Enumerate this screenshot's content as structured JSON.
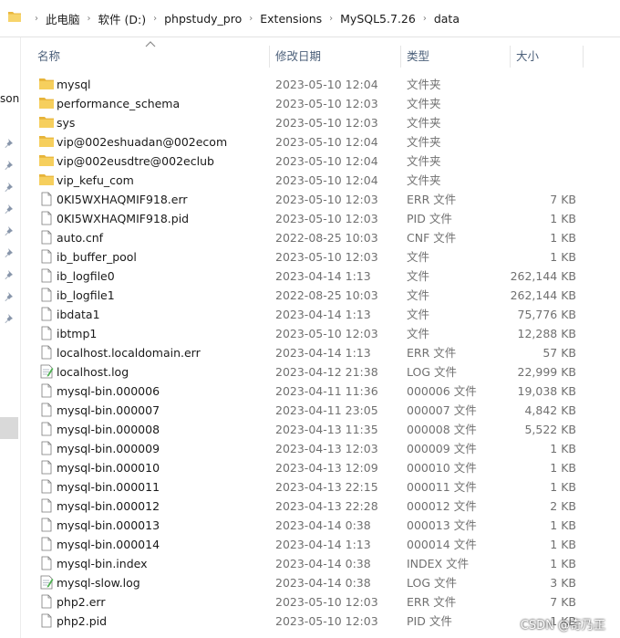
{
  "breadcrumb": [
    "此电脑",
    "软件 (D:)",
    "phpstudy_pro",
    "Extensions",
    "MySQL5.7.26",
    "data"
  ],
  "left_pane": {
    "clipped_text": "sona"
  },
  "columns": {
    "name": "名称",
    "date": "修改日期",
    "type": "类型",
    "size": "大小"
  },
  "icons": {
    "folder": "folder-icon",
    "file": "file-icon",
    "log": "log-file-icon",
    "pin": "pin-icon"
  },
  "colors": {
    "folder": "#f0c24a",
    "header_text": "#4c607a",
    "selection": "#d9d9d9"
  },
  "files": [
    {
      "name": "mysql",
      "date": "2023-05-10 12:04",
      "type": "文件夹",
      "size": "",
      "icon": "folder"
    },
    {
      "name": "performance_schema",
      "date": "2023-05-10 12:03",
      "type": "文件夹",
      "size": "",
      "icon": "folder"
    },
    {
      "name": "sys",
      "date": "2023-05-10 12:03",
      "type": "文件夹",
      "size": "",
      "icon": "folder"
    },
    {
      "name": "vip@002eshuadan@002ecom",
      "date": "2023-05-10 12:04",
      "type": "文件夹",
      "size": "",
      "icon": "folder"
    },
    {
      "name": "vip@002eusdtre@002eclub",
      "date": "2023-05-10 12:04",
      "type": "文件夹",
      "size": "",
      "icon": "folder"
    },
    {
      "name": "vip_kefu_com",
      "date": "2023-05-10 12:04",
      "type": "文件夹",
      "size": "",
      "icon": "folder"
    },
    {
      "name": "0KI5WXHAQMIF918.err",
      "date": "2023-05-10 12:03",
      "type": "ERR 文件",
      "size": "7 KB",
      "icon": "file"
    },
    {
      "name": "0KI5WXHAQMIF918.pid",
      "date": "2023-05-10 12:03",
      "type": "PID 文件",
      "size": "1 KB",
      "icon": "file"
    },
    {
      "name": "auto.cnf",
      "date": "2022-08-25 10:03",
      "type": "CNF 文件",
      "size": "1 KB",
      "icon": "file"
    },
    {
      "name": "ib_buffer_pool",
      "date": "2023-05-10 12:03",
      "type": "文件",
      "size": "1 KB",
      "icon": "file"
    },
    {
      "name": "ib_logfile0",
      "date": "2023-04-14 1:13",
      "type": "文件",
      "size": "262,144 KB",
      "icon": "file"
    },
    {
      "name": "ib_logfile1",
      "date": "2022-08-25 10:03",
      "type": "文件",
      "size": "262,144 KB",
      "icon": "file"
    },
    {
      "name": "ibdata1",
      "date": "2023-04-14 1:13",
      "type": "文件",
      "size": "75,776 KB",
      "icon": "file"
    },
    {
      "name": "ibtmp1",
      "date": "2023-05-10 12:03",
      "type": "文件",
      "size": "12,288 KB",
      "icon": "file"
    },
    {
      "name": "localhost.localdomain.err",
      "date": "2023-04-14 1:13",
      "type": "ERR 文件",
      "size": "57 KB",
      "icon": "file"
    },
    {
      "name": "localhost.log",
      "date": "2023-04-12 21:38",
      "type": "LOG 文件",
      "size": "22,999 KB",
      "icon": "log"
    },
    {
      "name": "mysql-bin.000006",
      "date": "2023-04-11 11:36",
      "type": "000006 文件",
      "size": "19,038 KB",
      "icon": "file"
    },
    {
      "name": "mysql-bin.000007",
      "date": "2023-04-11 23:05",
      "type": "000007 文件",
      "size": "4,842 KB",
      "icon": "file"
    },
    {
      "name": "mysql-bin.000008",
      "date": "2023-04-13 11:35",
      "type": "000008 文件",
      "size": "5,522 KB",
      "icon": "file"
    },
    {
      "name": "mysql-bin.000009",
      "date": "2023-04-13 12:03",
      "type": "000009 文件",
      "size": "1 KB",
      "icon": "file"
    },
    {
      "name": "mysql-bin.000010",
      "date": "2023-04-13 12:09",
      "type": "000010 文件",
      "size": "1 KB",
      "icon": "file"
    },
    {
      "name": "mysql-bin.000011",
      "date": "2023-04-13 22:15",
      "type": "000011 文件",
      "size": "1 KB",
      "icon": "file"
    },
    {
      "name": "mysql-bin.000012",
      "date": "2023-04-13 22:28",
      "type": "000012 文件",
      "size": "2 KB",
      "icon": "file"
    },
    {
      "name": "mysql-bin.000013",
      "date": "2023-04-14 0:38",
      "type": "000013 文件",
      "size": "1 KB",
      "icon": "file"
    },
    {
      "name": "mysql-bin.000014",
      "date": "2023-04-14 1:13",
      "type": "000014 文件",
      "size": "1 KB",
      "icon": "file"
    },
    {
      "name": "mysql-bin.index",
      "date": "2023-04-14 0:38",
      "type": "INDEX 文件",
      "size": "1 KB",
      "icon": "file"
    },
    {
      "name": "mysql-slow.log",
      "date": "2023-04-14 0:38",
      "type": "LOG 文件",
      "size": "3 KB",
      "icon": "log"
    },
    {
      "name": "php2.err",
      "date": "2023-05-10 12:03",
      "type": "ERR 文件",
      "size": "7 KB",
      "icon": "file"
    },
    {
      "name": "php2.pid",
      "date": "2023-05-10 12:03",
      "type": "PID 文件",
      "size": "1 KB",
      "icon": "file"
    }
  ],
  "watermark": "CSDN @奇乃正"
}
